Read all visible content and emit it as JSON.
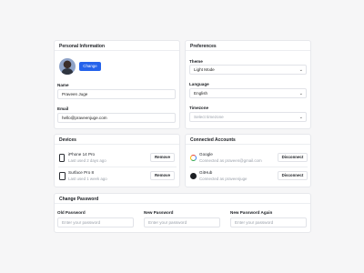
{
  "personal": {
    "heading": "Personal Information",
    "change_button": "Change",
    "name_label": "Name",
    "name_value": "Praveen Juge",
    "email_label": "Email",
    "email_value": "hello@praveenjuge.com"
  },
  "preferences": {
    "heading": "Preferences",
    "theme_label": "Theme",
    "theme_value": "Light Mode",
    "language_label": "Language",
    "language_value": "English",
    "timezone_label": "Timezone",
    "timezone_placeholder": "Select timezone"
  },
  "devices": {
    "heading": "Devices",
    "items": [
      {
        "name": "iPhone 14 Pro",
        "status": "Last used 2 days ago",
        "icon": "phone-icon",
        "action": "Remove"
      },
      {
        "name": "Surface Pro 8",
        "status": "Last used 1 week ago",
        "icon": "tablet-icon",
        "action": "Remove"
      }
    ]
  },
  "accounts": {
    "heading": "Connected Accounts",
    "items": [
      {
        "name": "Google",
        "status": "Connected as praveen@gmail.com",
        "icon": "google-icon",
        "action": "Disconnect"
      },
      {
        "name": "GitHub",
        "status": "Connected as praveenjuge",
        "icon": "github-icon",
        "action": "Disconnect"
      }
    ]
  },
  "password": {
    "heading": "Change Password",
    "old_label": "Old Password",
    "old_placeholder": "Enter your password",
    "new_label": "New Password",
    "new_placeholder": "Enter your password",
    "again_label": "New Password Again",
    "again_placeholder": "Enter your password"
  },
  "colors": {
    "accent": "#2563eb",
    "background": "#f6f6f7",
    "border": "#e7e8ec",
    "muted_text": "#9aa0aa"
  }
}
